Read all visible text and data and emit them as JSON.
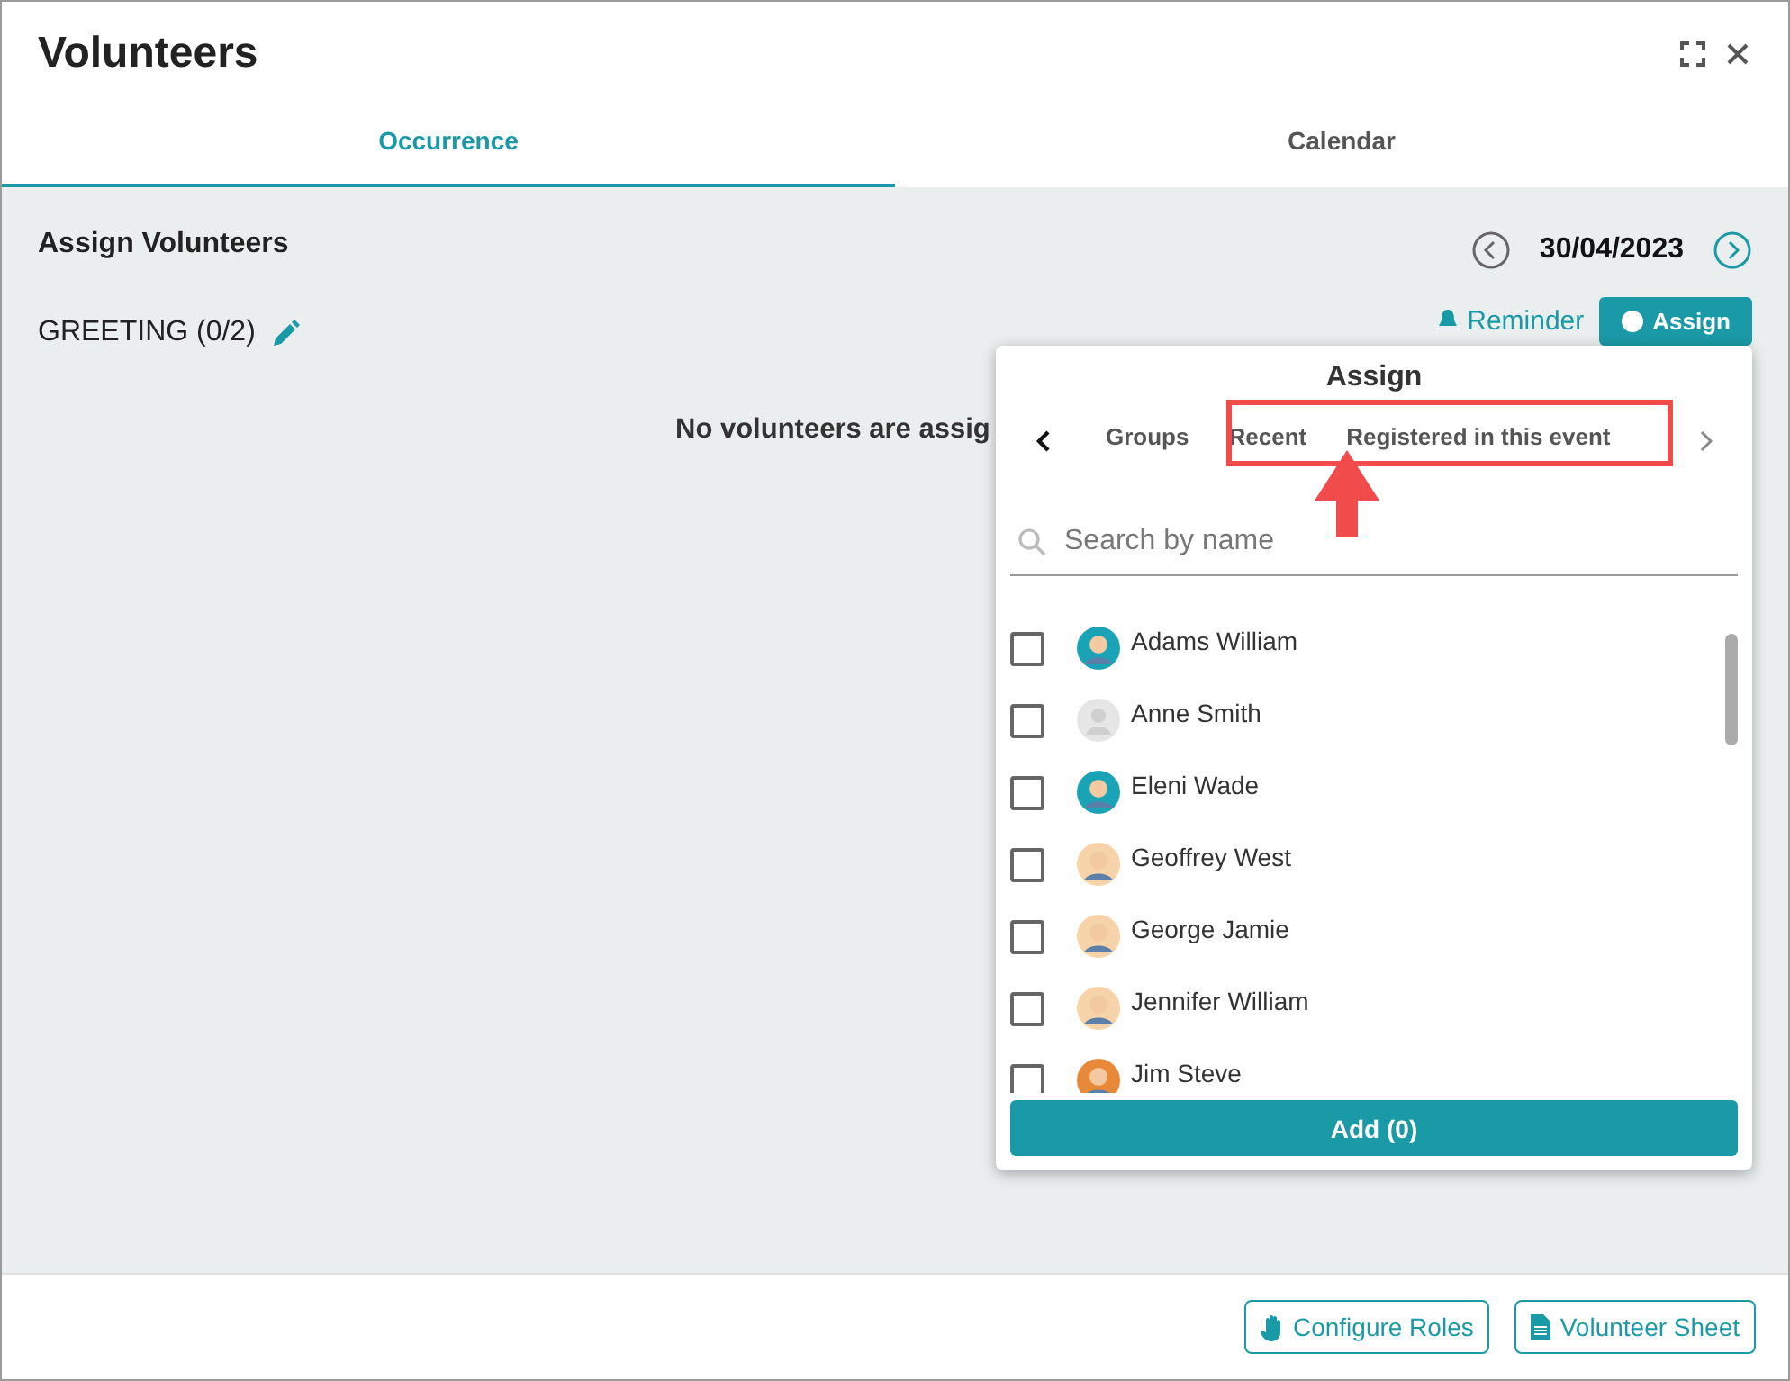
{
  "window": {
    "title": "Volunteers"
  },
  "tabs": [
    {
      "label": "Occurrence",
      "selected": true
    },
    {
      "label": "Calendar",
      "selected": false
    }
  ],
  "section": {
    "title": "Assign Volunteers",
    "date": "30/04/2023"
  },
  "role": {
    "label": "GREETING (0/2)",
    "reminder": "Reminder",
    "assign": "Assign",
    "empty_message": "No volunteers are assig"
  },
  "popup": {
    "title": "Assign",
    "tabs": [
      {
        "label": "Groups"
      },
      {
        "label": "Recent"
      },
      {
        "label": "Registered in this event"
      }
    ],
    "search": {
      "placeholder": "Search by name"
    },
    "people": [
      {
        "name": "Adams William",
        "checked": false,
        "kind": "person",
        "color": "#1aa3b5"
      },
      {
        "name": "Anne Smith",
        "checked": false,
        "kind": "blank",
        "color": "#e6e6e6"
      },
      {
        "name": "Eleni Wade",
        "checked": false,
        "kind": "person",
        "color": "#1aa3b5"
      },
      {
        "name": "Geoffrey West",
        "checked": false,
        "kind": "person",
        "color": "#f6d3a8"
      },
      {
        "name": "George Jamie",
        "checked": false,
        "kind": "person",
        "color": "#f6d3a8"
      },
      {
        "name": "Jennifer William",
        "checked": false,
        "kind": "person",
        "color": "#f6d3a8"
      },
      {
        "name": "Jim Steve",
        "checked": false,
        "kind": "person",
        "color": "#e8893a"
      }
    ],
    "add_button": "Add (0)"
  },
  "footer": {
    "buttons": [
      {
        "label": "Configure Roles",
        "kind": "hand"
      },
      {
        "label": "Volunteer Sheet",
        "kind": "sheet"
      }
    ]
  }
}
